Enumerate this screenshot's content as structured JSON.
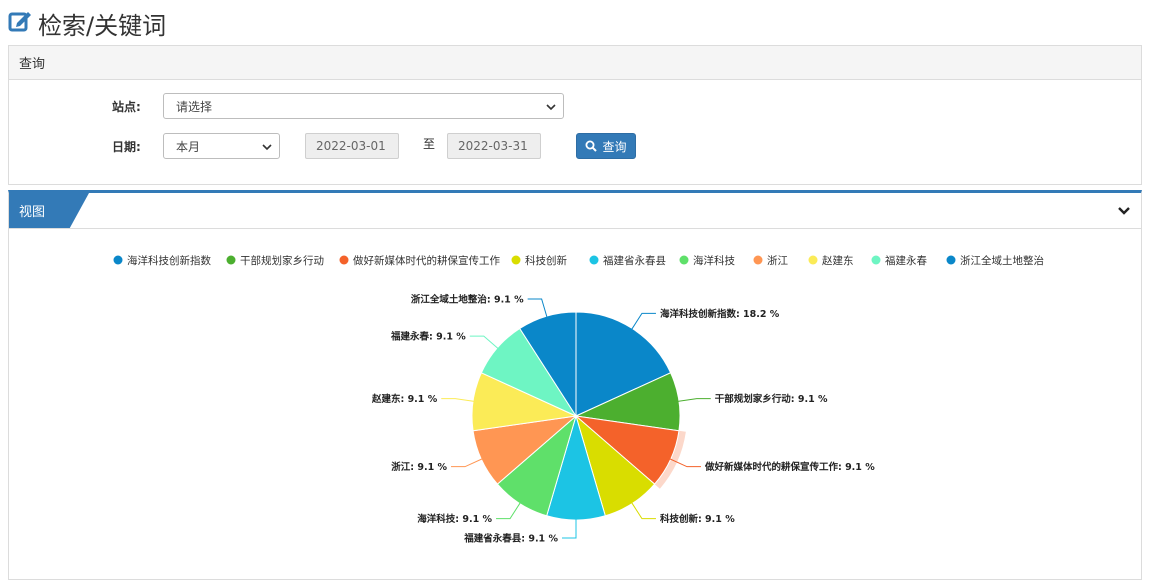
{
  "header": {
    "title": "检索/关键词",
    "icon": "edit-icon"
  },
  "query_panel": {
    "title": "查询",
    "site_label": "站点:",
    "site_value": "请选择",
    "date_label": "日期:",
    "date_range_value": "本月",
    "start_date": "2022-03-01",
    "to_label": "至",
    "end_date": "2022-03-31",
    "query_button": "查询",
    "query_icon": "search-icon"
  },
  "view_panel": {
    "title": "视图",
    "collapse_icon": "chevron-down-icon"
  },
  "colors": {
    "primary": "#337ab7"
  },
  "chart_data": {
    "type": "pie",
    "title": "",
    "legend_position": "top",
    "series": [
      {
        "data": [
          {
            "name": "海洋科技创新指数",
            "value": 18.2,
            "label": "海洋科技创新指数: 18.2 %",
            "color": "#0a87c9"
          },
          {
            "name": "干部规划家乡行动",
            "value": 9.1,
            "label": "干部规划家乡行动: 9.1 %",
            "color": "#4caf2f"
          },
          {
            "name": "做好新媒体时代的耕保宣传工作",
            "value": 9.1,
            "label": "做好新媒体时代的耕保宣传工作: 9.1 %",
            "color": "#f4622a"
          },
          {
            "name": "科技创新",
            "value": 9.1,
            "label": "科技创新: 9.1 %",
            "color": "#d9dd00"
          },
          {
            "name": "福建省永春县",
            "value": 9.1,
            "label": "福建省永春县: 9.1 %",
            "color": "#1cc4e4"
          },
          {
            "name": "海洋科技",
            "value": 9.1,
            "label": "海洋科技: 9.1 %",
            "color": "#5fe06a"
          },
          {
            "name": "浙江",
            "value": 9.1,
            "label": "浙江: 9.1 %",
            "color": "#ff9653"
          },
          {
            "name": "赵建东",
            "value": 9.1,
            "label": "赵建东: 9.1 %",
            "color": "#fbeb57"
          },
          {
            "name": "福建永春",
            "value": 9.1,
            "label": "福建永春: 9.1 %",
            "color": "#6ef5c3"
          },
          {
            "name": "浙江全域土地整治",
            "value": 9.1,
            "label": "浙江全域土地整治: 9.1 %",
            "color": "#0a87c9"
          }
        ]
      }
    ]
  }
}
